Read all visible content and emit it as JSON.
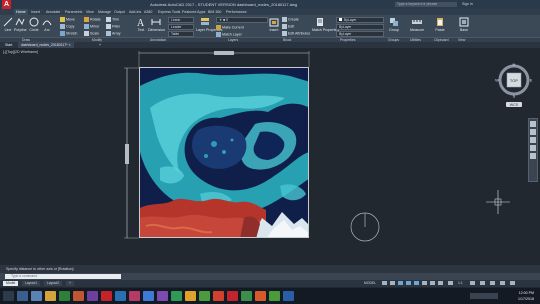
{
  "titlebar": {
    "app_title": "Autodesk AutoCAD 2017 - STUDENT VERSION   dashboard_nodes_20180117.dwg",
    "search_placeholder": "Type a keyword or phrase",
    "sign_in": "Sign In"
  },
  "ribbon_tabs": [
    "Home",
    "Insert",
    "Annotate",
    "Parametric",
    "View",
    "Manage",
    "Output",
    "Add-ins",
    "A360",
    "Express Tools",
    "Featured Apps",
    "BIM 360",
    "Performance"
  ],
  "ribbon_active_tab": "Home",
  "draw_tools": [
    "Line",
    "Polyline",
    "Circle",
    "Arc"
  ],
  "modify_tools": {
    "col1": [
      "Move",
      "Copy",
      "Stretch"
    ],
    "col2": [
      "Rotate",
      "Mirror",
      "Scale"
    ],
    "col3": [
      "Trim",
      "Fillet",
      "Array"
    ]
  },
  "annotation_tools": [
    "Text",
    "Dimension",
    "Linear",
    "Leader",
    "Table"
  ],
  "layer_tools": [
    "Layer Properties",
    "Make Current",
    "Match Layer"
  ],
  "block_tools": [
    "Insert",
    "Create",
    "Edit",
    "Edit Attributes"
  ],
  "property_tools": [
    "Match Properties",
    "ByLayer",
    "ByLayer",
    "ByLayer"
  ],
  "group_tools": [
    "Group"
  ],
  "utility_tools": [
    "Measure"
  ],
  "clipboard_tools": [
    "Paste"
  ],
  "view_tools": [
    "Base"
  ],
  "panel_labels": [
    "Draw",
    "Modify",
    "Annotation",
    "Layers",
    "Block",
    "Properties",
    "Groups",
    "Utilities",
    "Clipboard",
    "View"
  ],
  "file_tabs": [
    "Start",
    "dashboard_nodes_20180117*"
  ],
  "viewport_label": "[-][Top][2D Wireframe]",
  "viewcube": {
    "top": "TOP",
    "n": "N",
    "s": "S",
    "e": "E",
    "w": "W",
    "wcs": "WCS"
  },
  "command_history": "Specify distance to other axis or [Rotation]:",
  "command_placeholder": "Type a command",
  "layout_tabs": [
    "Model",
    "Layout1",
    "Layout2"
  ],
  "status": {
    "model": "MODEL",
    "scale": "1:1"
  },
  "clock": {
    "time": "12:00 PM",
    "date": "1/17/2018"
  },
  "colors": {
    "accent": "#c4232b",
    "ribbon": "#3b4856",
    "canvas": "#212830"
  }
}
